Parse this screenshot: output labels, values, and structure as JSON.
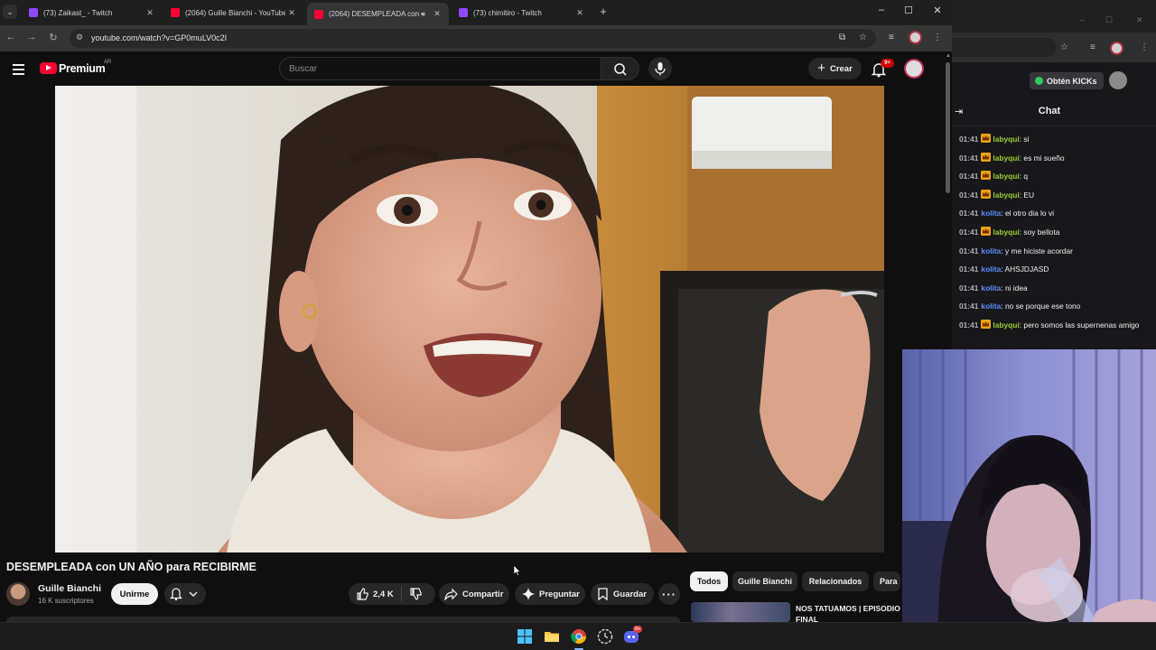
{
  "browser": {
    "tabs": [
      {
        "title": "(73) Zaikast_ - Twitch",
        "favicon": "twitch-icon",
        "audio": false
      },
      {
        "title": "(2064) Guille Bianchi - YouTube",
        "favicon": "youtube-icon",
        "audio": false
      },
      {
        "title": "(2064) DESEMPLEADA con",
        "favicon": "youtube-icon",
        "audio": true
      },
      {
        "title": "(73) chimitiro - Twitch",
        "favicon": "twitch-icon",
        "audio": false
      }
    ],
    "url": "youtube.com/watch?v=GP0muLV0c2I"
  },
  "youtube": {
    "brand": "Premium",
    "country": "AR",
    "search_placeholder": "Buscar",
    "create_label": "Crear",
    "notification_count": "9+",
    "video": {
      "title": "DESEMPLEADA con UN AÑO para RECIBIRME",
      "channel": "Guille Bianchi",
      "subscribers": "16 K suscriptores",
      "join_label": "Unirme",
      "likes": "2,4 K",
      "share_label": "Compartir",
      "ask_label": "Preguntar",
      "save_label": "Guardar"
    },
    "chips": [
      "Todos",
      "Guille Bianchi",
      "Relacionados",
      "Para"
    ],
    "recommendation": {
      "title": "NOS TATUAMOS | EPISODIO FINAL"
    }
  },
  "twitch": {
    "kicks_label": "Obtén KICKs",
    "chat_title": "Chat",
    "messages": [
      {
        "time": "01:41",
        "user": "labyqui",
        "color": "#9acd32",
        "badge": true,
        "text": "si"
      },
      {
        "time": "01:41",
        "user": "labyqui",
        "color": "#9acd32",
        "badge": true,
        "text": "es mi sueño"
      },
      {
        "time": "01:41",
        "user": "labyqui",
        "color": "#9acd32",
        "badge": true,
        "text": "q"
      },
      {
        "time": "01:41",
        "user": "labyqui",
        "color": "#9acd32",
        "badge": true,
        "text": "EU"
      },
      {
        "time": "01:41",
        "user": "kolita",
        "color": "#5b8fff",
        "badge": false,
        "text": "el otro dia lo vi"
      },
      {
        "time": "01:41",
        "user": "labyqui",
        "color": "#9acd32",
        "badge": true,
        "text": "soy bellota"
      },
      {
        "time": "01:41",
        "user": "kolita",
        "color": "#5b8fff",
        "badge": false,
        "text": "y me hiciste acordar"
      },
      {
        "time": "01:41",
        "user": "kolita",
        "color": "#5b8fff",
        "badge": false,
        "text": "AHSJDJASD"
      },
      {
        "time": "01:41",
        "user": "kolita",
        "color": "#5b8fff",
        "badge": false,
        "text": "ni idea"
      },
      {
        "time": "01:41",
        "user": "kolita",
        "color": "#5b8fff",
        "badge": false,
        "text": "no se porque ese tono"
      },
      {
        "time": "01:41",
        "user": "labyqui",
        "color": "#9acd32",
        "badge": true,
        "text": "pero somos las supernenas amigo"
      }
    ]
  },
  "taskbar": {
    "apps": [
      "windows-start-icon",
      "file-explorer-icon",
      "chrome-icon",
      "clock-app-icon",
      "discord-icon"
    ],
    "discord_badge": "9+"
  }
}
